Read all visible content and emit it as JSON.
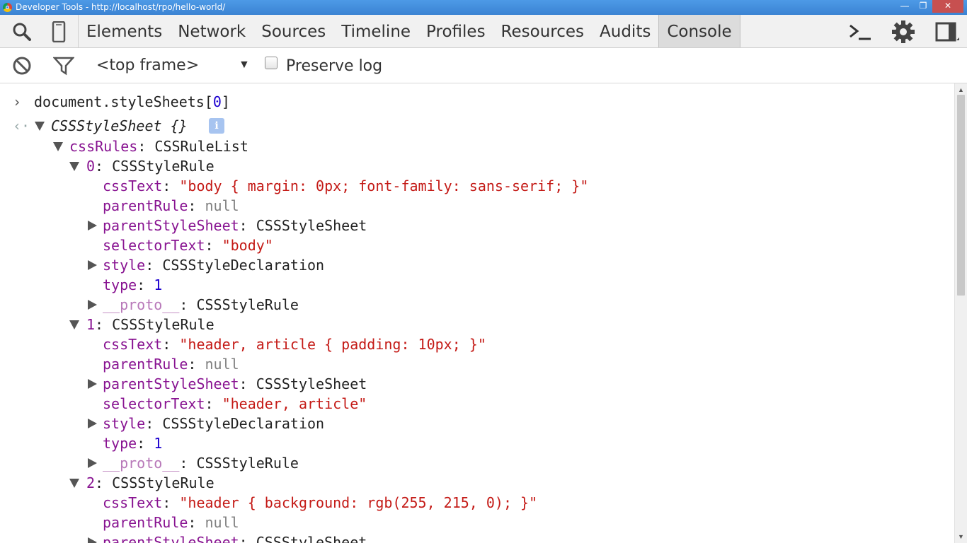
{
  "window": {
    "title": "Developer Tools - http://localhost/rpo/hello-world/"
  },
  "toolbar": {
    "tabs": [
      "Elements",
      "Network",
      "Sources",
      "Timeline",
      "Profiles",
      "Resources",
      "Audits",
      "Console"
    ],
    "active_tab": "Console"
  },
  "filterbar": {
    "frame": "<top frame>",
    "preserve_log_label": "Preserve log",
    "preserve_log_checked": false
  },
  "console": {
    "input_prompt": "document.styleSheets[",
    "input_index": "0",
    "input_close": "]",
    "result_type": "CSSStyleSheet {}",
    "cssRules": {
      "key": "cssRules",
      "value": "CSSRuleList"
    },
    "rules": [
      {
        "index": "0",
        "type_name": "CSSStyleRule",
        "cssText": "\"body { margin: 0px; font-family: sans-serif; }\"",
        "parentRule": "null",
        "parentStyleSheet": "CSSStyleSheet",
        "selectorText": "\"body\"",
        "style": "CSSStyleDeclaration",
        "type": "1",
        "proto": "CSSStyleRule"
      },
      {
        "index": "1",
        "type_name": "CSSStyleRule",
        "cssText": "\"header, article { padding: 10px; }\"",
        "parentRule": "null",
        "parentStyleSheet": "CSSStyleSheet",
        "selectorText": "\"header, article\"",
        "style": "CSSStyleDeclaration",
        "type": "1",
        "proto": "CSSStyleRule"
      },
      {
        "index": "2",
        "type_name": "CSSStyleRule",
        "cssText": "\"header { background: rgb(255, 215, 0); }\"",
        "parentRule": "null",
        "parentStyleSheet": "CSSStyleSheet"
      }
    ],
    "keys": {
      "cssText": "cssText",
      "parentRule": "parentRule",
      "parentStyleSheet": "parentStyleSheet",
      "selectorText": "selectorText",
      "style": "style",
      "type": "type",
      "proto": "__proto__"
    }
  }
}
